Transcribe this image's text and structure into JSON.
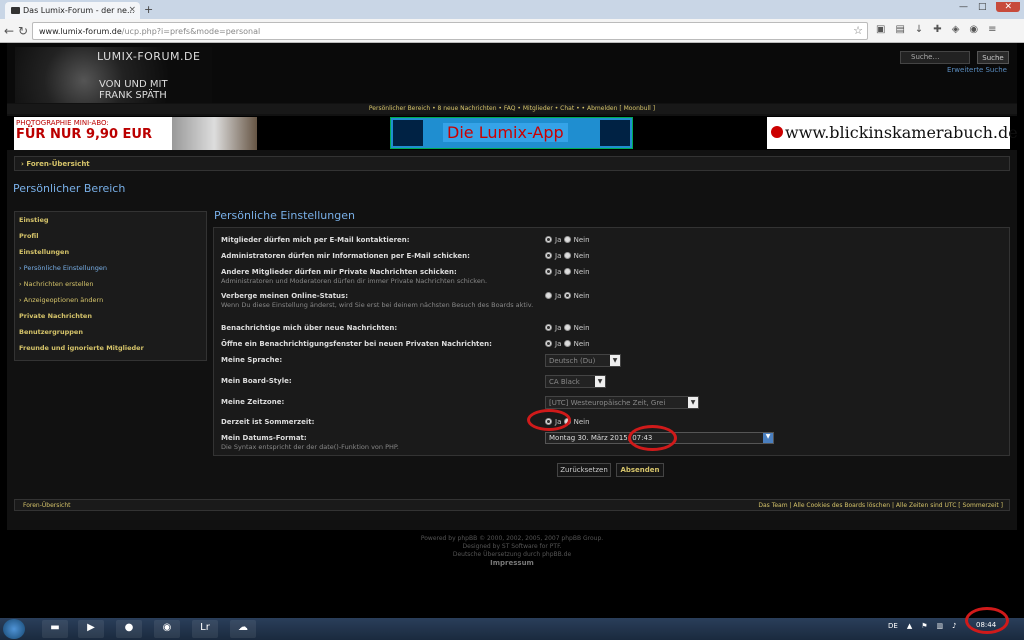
{
  "browser": {
    "tab_title": "Das Lumix-Forum - der ne...",
    "url_domain": "www.lumix-forum.de",
    "url_path": "/ucp.php?i=prefs&mode=personal"
  },
  "header": {
    "logo_line1": "LUMIX-FORUM.DE",
    "logo_line2": "VON UND MIT",
    "logo_line3": "FRANK SPÄTH",
    "search_placeholder": "Suche…",
    "search_button": "Suche",
    "advanced_search": "Erweiterte Suche"
  },
  "navbar": "Persönlicher Bereich  •  8 neue Nachrichten  •  FAQ  •  Mitglieder  •  Chat  •  •  Abmelden [ Moonbull ]",
  "banners": {
    "b1_line1": "PHOTOGRAPHIE MINI-ABO:",
    "b1_line2": "FÜR NUR 9,90 EUR",
    "b2": "Die Lumix-App",
    "b3": "www.blickinskamerabuch.de"
  },
  "breadcrumb": "› Foren-Übersicht",
  "page_title": "Persönlicher Bereich",
  "sidebar": [
    "Einstieg",
    "Profil",
    "Einstellungen",
    "› Persönliche Einstellungen",
    "› Nachrichten erstellen",
    "› Anzeigeoptionen ändern",
    "Private Nachrichten",
    "Benutzergruppen",
    "Freunde und ignorierte Mitglieder"
  ],
  "section_title": "Persönliche Einstellungen",
  "rows": [
    {
      "label": "Mitglieder dürfen mich per E-Mail kontaktieren:",
      "desc": "",
      "yes": "Ja",
      "no": "Nein"
    },
    {
      "label": "Administratoren dürfen mir Informationen per E-Mail schicken:",
      "desc": "",
      "yes": "Ja",
      "no": "Nein"
    },
    {
      "label": "Andere Mitglieder dürfen mir Private Nachrichten schicken:",
      "desc": "Administratoren und Moderatoren dürfen dir immer Private Nachrichten schicken.",
      "yes": "Ja",
      "no": "Nein"
    },
    {
      "label": "Verberge meinen Online-Status:",
      "desc": "Wenn Du diese Einstellung änderst, wird Sie erst bei deinem nächsten Besuch des Boards aktiv.",
      "yes": "Ja",
      "no": "Nein"
    },
    {
      "label": "Benachrichtige mich über neue Nachrichten:",
      "desc": "",
      "yes": "Ja",
      "no": "Nein"
    },
    {
      "label": "Öffne ein Benachrichtigungsfenster bei neuen Privaten Nachrichten:",
      "desc": "",
      "yes": "Ja",
      "no": "Nein"
    },
    {
      "label": "Meine Sprache:",
      "value": "Deutsch (Du)"
    },
    {
      "label": "Mein Board-Style:",
      "value": "CA Black"
    },
    {
      "label": "Meine Zeitzone:",
      "value": "[UTC] Westeuropäische Zeit, Grei"
    },
    {
      "label": "Derzeit ist Sommerzeit:",
      "desc": "",
      "yes": "Ja",
      "no": "Nein"
    },
    {
      "label": "Mein Datums-Format:",
      "desc": "Die Syntax entspricht der der date()-Funktion von PHP.",
      "value": "Montag 30. März 2015, 07:43"
    }
  ],
  "buttons": {
    "reset": "Zurücksetzen",
    "submit": "Absenden"
  },
  "footer": {
    "left": "Foren-Übersicht",
    "right": "Das Team | Alle Cookies des Boards löschen | Alle Zeiten sind UTC [ Sommerzeit ]"
  },
  "powered": [
    "Powered by phpBB © 2000, 2002, 2005, 2007 phpBB Group.",
    "Designed by ST Software for PTF.",
    "Deutsche Übersetzung durch phpBB.de",
    "Impressum"
  ],
  "taskbar": {
    "lang": "DE",
    "clock": "08:44"
  },
  "colors": {
    "accent_blue": "#79b0e8",
    "link_gold": "#d6c46a",
    "highlight_ring": "#d01a1a"
  }
}
